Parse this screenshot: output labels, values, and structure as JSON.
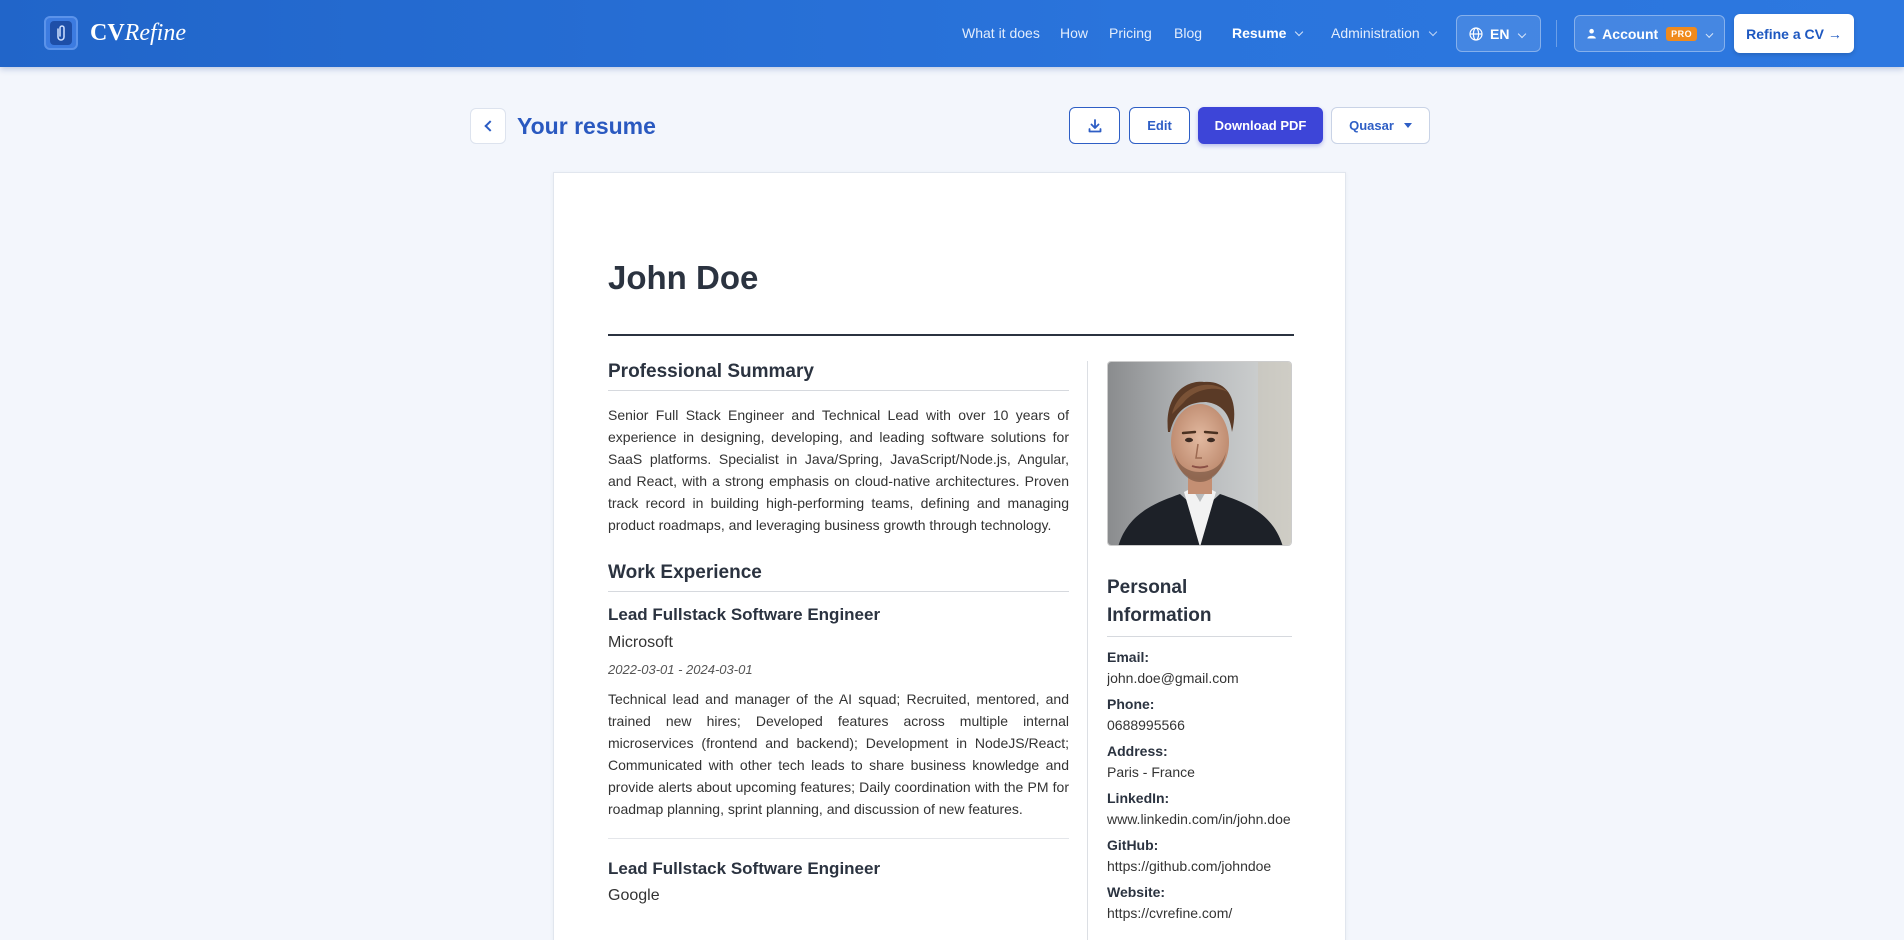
{
  "header": {
    "brand_strong": "CV",
    "brand_italic": "Refine",
    "nav": [
      "What it does",
      "How",
      "Pricing",
      "Blog"
    ],
    "resume_menu": "Resume",
    "admin_menu": "Administration",
    "language": "EN",
    "account": "Account",
    "pro_badge": "PRO",
    "cta": "Refine a CV →"
  },
  "toolbar": {
    "title": "Your resume",
    "edit": "Edit",
    "download_pdf": "Download PDF",
    "theme": "Quasar"
  },
  "resume": {
    "name": "John Doe",
    "summary_title": "Professional Summary",
    "summary": "Senior Full Stack Engineer and Technical Lead with over 10 years of experience in designing, developing, and leading software solutions for SaaS platforms. Specialist in Java/Spring, JavaScript/Node.js, Angular, and React, with a strong emphasis on cloud-native architectures. Proven track record in building high-performing teams, defining and managing product roadmaps, and leveraging business growth through technology.",
    "experience_title": "Work Experience",
    "jobs": [
      {
        "title": "Lead Fullstack Software Engineer",
        "company": "Microsoft",
        "dates": "2022-03-01 - 2024-03-01",
        "description": "Technical lead and manager of the AI squad; Recruited, mentored, and trained new hires; Developed features across multiple internal microservices (frontend and backend); Development in NodeJS/React; Communicated with other tech leads to share business knowledge and provide alerts about upcoming features; Daily coordination with the PM for roadmap planning, sprint planning, and discussion of new features."
      },
      {
        "title": "Lead Fullstack Software Engineer",
        "company": "Google"
      }
    ],
    "personal_title": "Personal Information",
    "personal": [
      {
        "label": "Email:",
        "value": "john.doe@gmail.com"
      },
      {
        "label": "Phone:",
        "value": "0688995566"
      },
      {
        "label": "Address:",
        "value": "Paris - France"
      },
      {
        "label": "LinkedIn:",
        "value": "www.linkedin.com/in/john.doe"
      },
      {
        "label": "GitHub:",
        "value": "https://github.com/johndoe"
      },
      {
        "label": "Website:",
        "value": "https://cvrefine.com/"
      }
    ]
  },
  "colors": {
    "header_bg": "#2a74dc",
    "primary_button": "#3d45d8",
    "pro_badge": "#f08a1c",
    "title_blue": "#2a59c0"
  },
  "icons": {
    "logo": "paperclip-icon",
    "language": "globe-icon",
    "account": "user-icon",
    "download": "download-icon",
    "back": "chevron-left-icon"
  }
}
